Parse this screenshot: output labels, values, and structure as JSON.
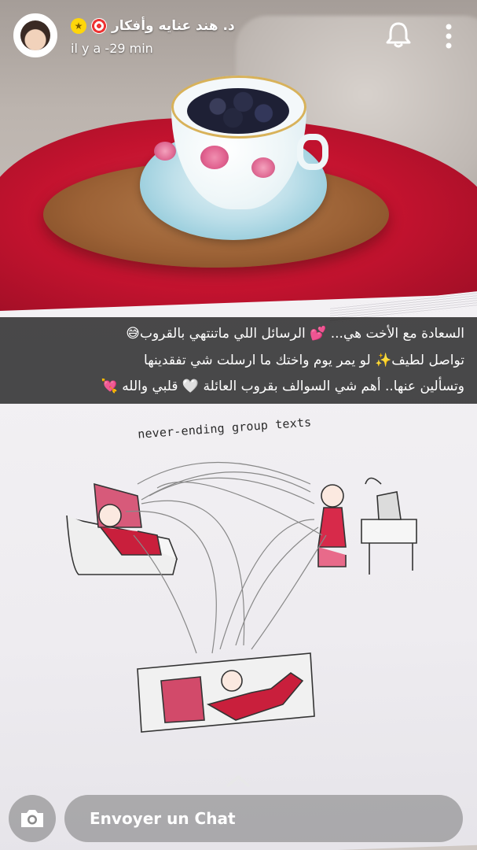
{
  "header": {
    "username": "د. هند عنايه وأفكار",
    "timestamp": "il y a -29 min",
    "avatar_icon": "bitmoji-avatar",
    "badges": [
      "target-emoji",
      "star-badge"
    ],
    "actions": [
      "bell-icon",
      "more-vertical-icon"
    ]
  },
  "caption": {
    "line1": "السعادة مع الأخت هي... 💕 الرسائل اللي ماتنتهي بالقروب😅",
    "line2": "تواصل لطيف✨ لو يمر يوم واختك ما ارسلت شي تفقدينها",
    "line3": "وتسألين عنها.. أهم شي السوالف بقروب العائلة 🤍 قلبي والله 💘"
  },
  "drawing": {
    "title": "never-ending group texts"
  },
  "footer": {
    "camera_icon": "camera-icon",
    "chat_placeholder": "Envoyer un Chat",
    "swipe_icon": "chevron-up-icon"
  },
  "colors": {
    "caption_bg": "#000000b3",
    "blanket": "#c4132f",
    "text": "#ffffff"
  }
}
